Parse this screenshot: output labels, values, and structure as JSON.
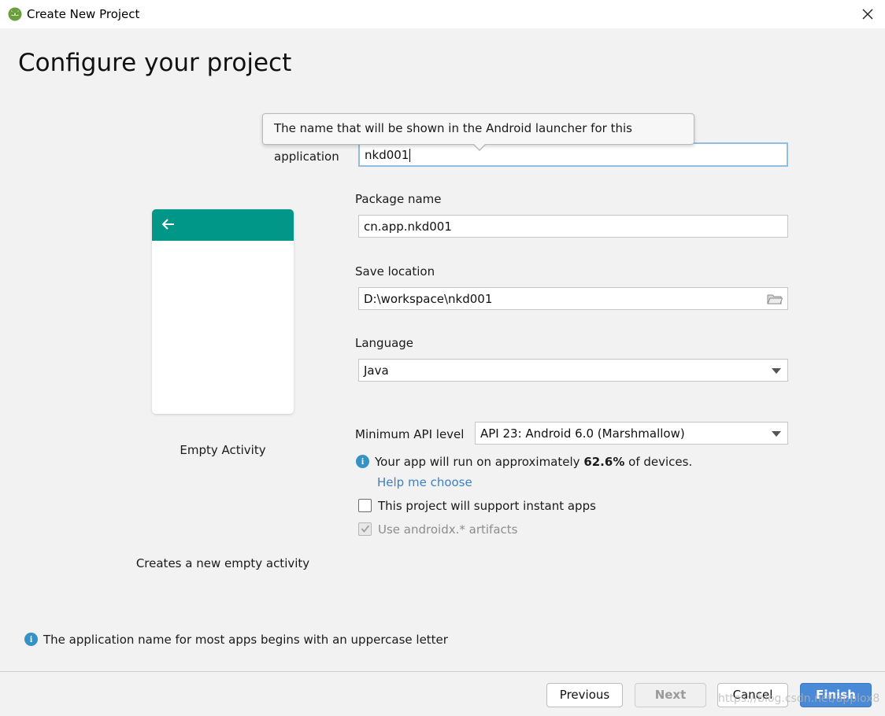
{
  "window": {
    "title": "Create New Project"
  },
  "page": {
    "heading": "Configure your project"
  },
  "tooltip": {
    "text": "The name that will be shown in the Android launcher for this application"
  },
  "form": {
    "name_value": "nkd001",
    "package_label": "Package name",
    "package_value": "cn.app.nkd001",
    "location_label": "Save location",
    "location_value": "D:\\workspace\\nkd001",
    "language_label": "Language",
    "language_value": "Java",
    "min_api_label": "Minimum API level",
    "min_api_value": "API 23: Android 6.0 (Marshmallow)",
    "coverage_prefix": "Your app will run on approximately",
    "coverage_percent": "62.6%",
    "coverage_suffix": "of devices.",
    "help_link": "Help me choose",
    "instant_apps_label": "This project will support instant apps",
    "instant_apps_checked": false,
    "androidx_label": "Use androidx.* artifacts",
    "androidx_checked": true
  },
  "preview": {
    "activity_name": "Empty Activity",
    "activity_description": "Creates a new empty activity",
    "accent_color": "#009688"
  },
  "footer": {
    "hint": "The application name for most apps begins with an uppercase letter"
  },
  "buttons": {
    "previous": "Previous",
    "next": "Next",
    "cancel": "Cancel",
    "finish": "Finish"
  },
  "watermark": {
    "text": "https://blog.csdn.net/applox8"
  },
  "colors": {
    "primary_button": "#4a89d6",
    "link": "#3d7fc4",
    "info_icon": "#3592c4"
  }
}
